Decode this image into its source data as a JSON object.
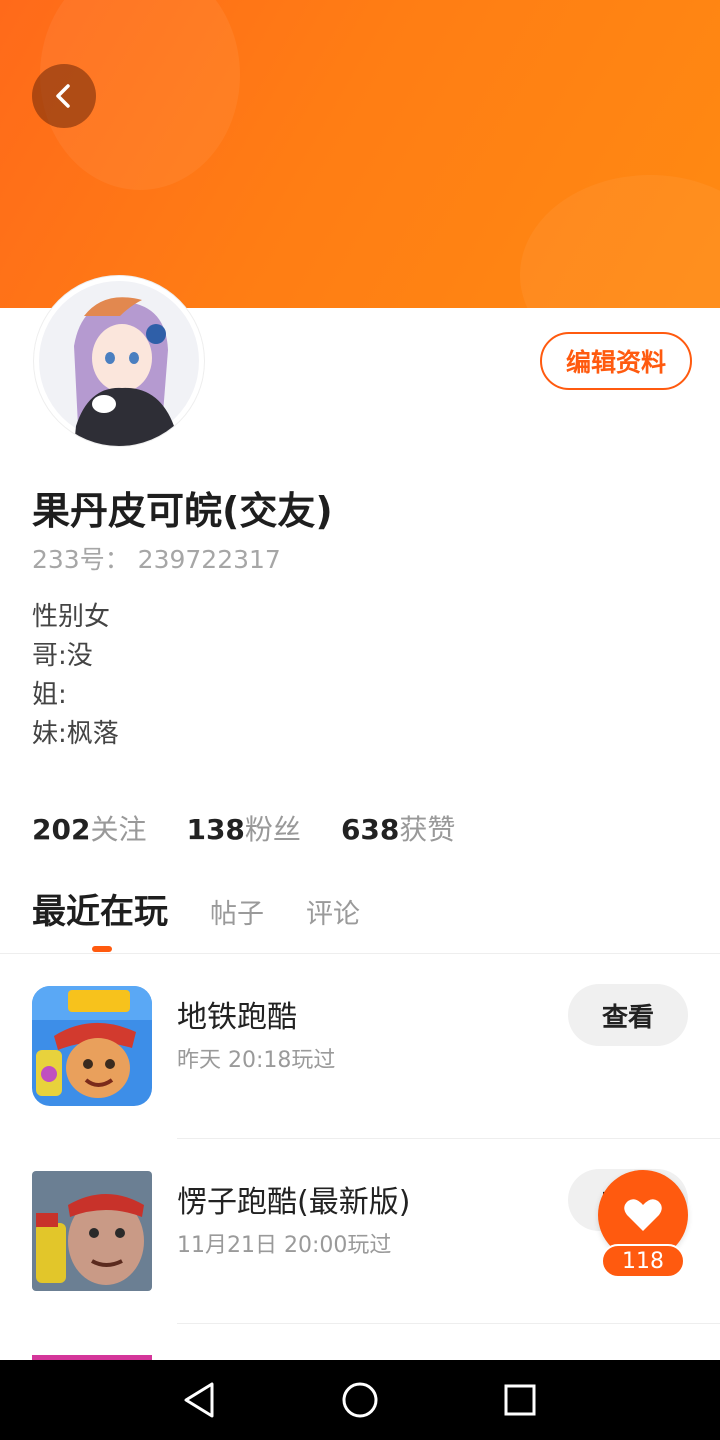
{
  "header": {
    "back_icon": "chevron-left-icon",
    "banner_color": "#ff7514"
  },
  "profile": {
    "edit_label": "编辑资料",
    "name": "果丹皮可皖(交友)",
    "uid": "233号： 239722317",
    "bio_lines": [
      "性别女",
      "哥:没",
      "姐:",
      "妹:枫落"
    ]
  },
  "stats": [
    {
      "num": "202",
      "label": "关注"
    },
    {
      "num": "138",
      "label": "粉丝"
    },
    {
      "num": "638",
      "label": "获赞"
    }
  ],
  "tabs": [
    {
      "label": "最近在玩",
      "active": true
    },
    {
      "label": "帖子",
      "active": false
    },
    {
      "label": "评论",
      "active": false
    }
  ],
  "games": [
    {
      "name": "地铁跑酷",
      "time": "昨天 20:18玩过",
      "button": "查看",
      "icon": "subway-surfers-icon"
    },
    {
      "name": "愣子跑酷(最新版)",
      "time": "11月21日 20:00玩过",
      "button": "查看",
      "icon": "runner-game-icon"
    }
  ],
  "like": {
    "count": "118",
    "icon": "heart-icon"
  },
  "accent_color": "#ff5a0f",
  "navbar": {
    "back": "back-triangle-icon",
    "home": "home-circle-icon",
    "recents": "recents-square-icon"
  }
}
